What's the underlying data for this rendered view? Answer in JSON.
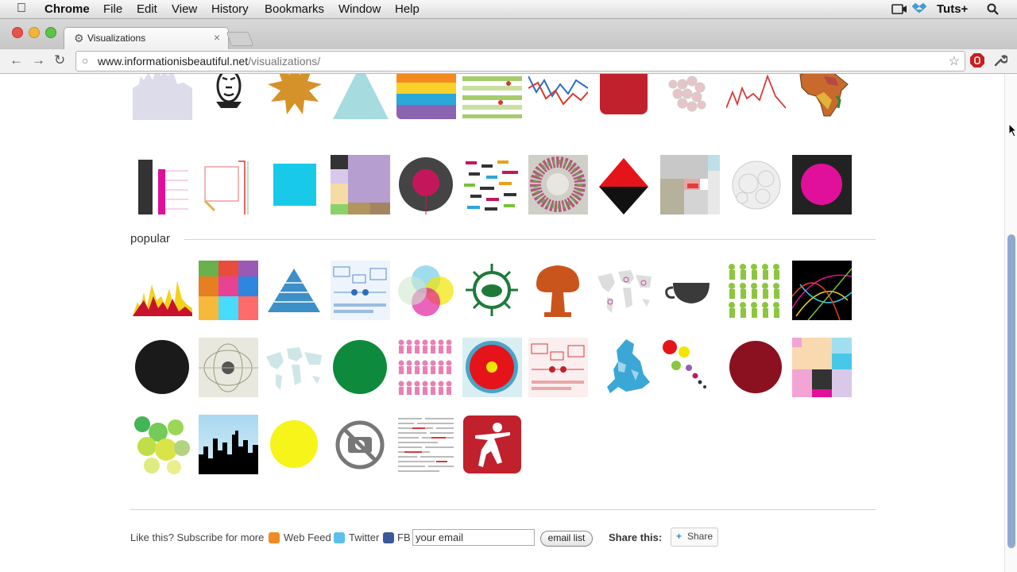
{
  "menubar": {
    "app_name": "Chrome",
    "items": [
      "File",
      "Edit",
      "View",
      "History",
      "Bookmarks",
      "Window",
      "Help"
    ],
    "right_label": "Tuts+"
  },
  "tab": {
    "title": "Visualizations",
    "close_glyph": "×"
  },
  "toolbar": {
    "url_domain": "www.informationisbeautiful.net",
    "url_path": "/visualizations/"
  },
  "page": {
    "popular_heading": "popular"
  },
  "footer": {
    "like_text": "Like this? Subscribe for more",
    "webfeed": "Web Feed",
    "twitter": "Twitter",
    "fb": "FB",
    "email_value": "your email",
    "email_button": "email list",
    "share_label": "Share this:",
    "share_button": "Share"
  },
  "colors": {
    "accent_red": "#c0212d",
    "scroll_thumb": "#8fa9cf",
    "magenta": "#e0109a"
  }
}
